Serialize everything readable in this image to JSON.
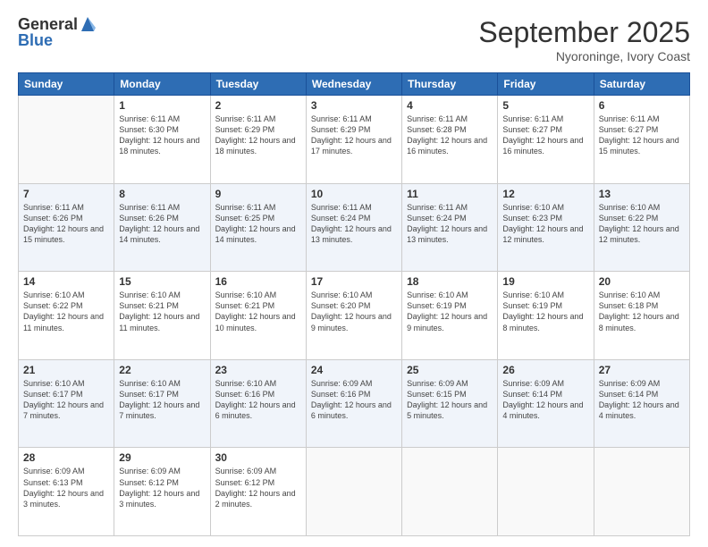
{
  "logo": {
    "general": "General",
    "blue": "Blue"
  },
  "header": {
    "month": "September 2025",
    "location": "Nyoroninge, Ivory Coast"
  },
  "weekdays": [
    "Sunday",
    "Monday",
    "Tuesday",
    "Wednesday",
    "Thursday",
    "Friday",
    "Saturday"
  ],
  "weeks": [
    [
      {
        "day": "",
        "sunrise": "",
        "sunset": "",
        "daylight": ""
      },
      {
        "day": "1",
        "sunrise": "Sunrise: 6:11 AM",
        "sunset": "Sunset: 6:30 PM",
        "daylight": "Daylight: 12 hours and 18 minutes."
      },
      {
        "day": "2",
        "sunrise": "Sunrise: 6:11 AM",
        "sunset": "Sunset: 6:29 PM",
        "daylight": "Daylight: 12 hours and 18 minutes."
      },
      {
        "day": "3",
        "sunrise": "Sunrise: 6:11 AM",
        "sunset": "Sunset: 6:29 PM",
        "daylight": "Daylight: 12 hours and 17 minutes."
      },
      {
        "day": "4",
        "sunrise": "Sunrise: 6:11 AM",
        "sunset": "Sunset: 6:28 PM",
        "daylight": "Daylight: 12 hours and 16 minutes."
      },
      {
        "day": "5",
        "sunrise": "Sunrise: 6:11 AM",
        "sunset": "Sunset: 6:27 PM",
        "daylight": "Daylight: 12 hours and 16 minutes."
      },
      {
        "day": "6",
        "sunrise": "Sunrise: 6:11 AM",
        "sunset": "Sunset: 6:27 PM",
        "daylight": "Daylight: 12 hours and 15 minutes."
      }
    ],
    [
      {
        "day": "7",
        "sunrise": "Sunrise: 6:11 AM",
        "sunset": "Sunset: 6:26 PM",
        "daylight": "Daylight: 12 hours and 15 minutes."
      },
      {
        "day": "8",
        "sunrise": "Sunrise: 6:11 AM",
        "sunset": "Sunset: 6:26 PM",
        "daylight": "Daylight: 12 hours and 14 minutes."
      },
      {
        "day": "9",
        "sunrise": "Sunrise: 6:11 AM",
        "sunset": "Sunset: 6:25 PM",
        "daylight": "Daylight: 12 hours and 14 minutes."
      },
      {
        "day": "10",
        "sunrise": "Sunrise: 6:11 AM",
        "sunset": "Sunset: 6:24 PM",
        "daylight": "Daylight: 12 hours and 13 minutes."
      },
      {
        "day": "11",
        "sunrise": "Sunrise: 6:11 AM",
        "sunset": "Sunset: 6:24 PM",
        "daylight": "Daylight: 12 hours and 13 minutes."
      },
      {
        "day": "12",
        "sunrise": "Sunrise: 6:10 AM",
        "sunset": "Sunset: 6:23 PM",
        "daylight": "Daylight: 12 hours and 12 minutes."
      },
      {
        "day": "13",
        "sunrise": "Sunrise: 6:10 AM",
        "sunset": "Sunset: 6:22 PM",
        "daylight": "Daylight: 12 hours and 12 minutes."
      }
    ],
    [
      {
        "day": "14",
        "sunrise": "Sunrise: 6:10 AM",
        "sunset": "Sunset: 6:22 PM",
        "daylight": "Daylight: 12 hours and 11 minutes."
      },
      {
        "day": "15",
        "sunrise": "Sunrise: 6:10 AM",
        "sunset": "Sunset: 6:21 PM",
        "daylight": "Daylight: 12 hours and 11 minutes."
      },
      {
        "day": "16",
        "sunrise": "Sunrise: 6:10 AM",
        "sunset": "Sunset: 6:21 PM",
        "daylight": "Daylight: 12 hours and 10 minutes."
      },
      {
        "day": "17",
        "sunrise": "Sunrise: 6:10 AM",
        "sunset": "Sunset: 6:20 PM",
        "daylight": "Daylight: 12 hours and 9 minutes."
      },
      {
        "day": "18",
        "sunrise": "Sunrise: 6:10 AM",
        "sunset": "Sunset: 6:19 PM",
        "daylight": "Daylight: 12 hours and 9 minutes."
      },
      {
        "day": "19",
        "sunrise": "Sunrise: 6:10 AM",
        "sunset": "Sunset: 6:19 PM",
        "daylight": "Daylight: 12 hours and 8 minutes."
      },
      {
        "day": "20",
        "sunrise": "Sunrise: 6:10 AM",
        "sunset": "Sunset: 6:18 PM",
        "daylight": "Daylight: 12 hours and 8 minutes."
      }
    ],
    [
      {
        "day": "21",
        "sunrise": "Sunrise: 6:10 AM",
        "sunset": "Sunset: 6:17 PM",
        "daylight": "Daylight: 12 hours and 7 minutes."
      },
      {
        "day": "22",
        "sunrise": "Sunrise: 6:10 AM",
        "sunset": "Sunset: 6:17 PM",
        "daylight": "Daylight: 12 hours and 7 minutes."
      },
      {
        "day": "23",
        "sunrise": "Sunrise: 6:10 AM",
        "sunset": "Sunset: 6:16 PM",
        "daylight": "Daylight: 12 hours and 6 minutes."
      },
      {
        "day": "24",
        "sunrise": "Sunrise: 6:09 AM",
        "sunset": "Sunset: 6:16 PM",
        "daylight": "Daylight: 12 hours and 6 minutes."
      },
      {
        "day": "25",
        "sunrise": "Sunrise: 6:09 AM",
        "sunset": "Sunset: 6:15 PM",
        "daylight": "Daylight: 12 hours and 5 minutes."
      },
      {
        "day": "26",
        "sunrise": "Sunrise: 6:09 AM",
        "sunset": "Sunset: 6:14 PM",
        "daylight": "Daylight: 12 hours and 4 minutes."
      },
      {
        "day": "27",
        "sunrise": "Sunrise: 6:09 AM",
        "sunset": "Sunset: 6:14 PM",
        "daylight": "Daylight: 12 hours and 4 minutes."
      }
    ],
    [
      {
        "day": "28",
        "sunrise": "Sunrise: 6:09 AM",
        "sunset": "Sunset: 6:13 PM",
        "daylight": "Daylight: 12 hours and 3 minutes."
      },
      {
        "day": "29",
        "sunrise": "Sunrise: 6:09 AM",
        "sunset": "Sunset: 6:12 PM",
        "daylight": "Daylight: 12 hours and 3 minutes."
      },
      {
        "day": "30",
        "sunrise": "Sunrise: 6:09 AM",
        "sunset": "Sunset: 6:12 PM",
        "daylight": "Daylight: 12 hours and 2 minutes."
      },
      {
        "day": "",
        "sunrise": "",
        "sunset": "",
        "daylight": ""
      },
      {
        "day": "",
        "sunrise": "",
        "sunset": "",
        "daylight": ""
      },
      {
        "day": "",
        "sunrise": "",
        "sunset": "",
        "daylight": ""
      },
      {
        "day": "",
        "sunrise": "",
        "sunset": "",
        "daylight": ""
      }
    ]
  ]
}
